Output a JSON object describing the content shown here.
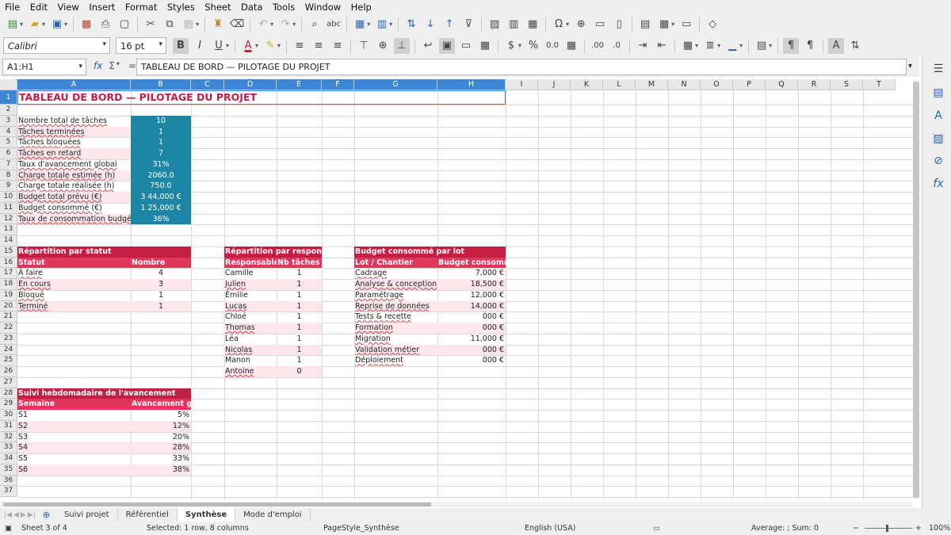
{
  "menu": [
    "File",
    "Edit",
    "View",
    "Insert",
    "Format",
    "Styles",
    "Sheet",
    "Data",
    "Tools",
    "Window",
    "Help"
  ],
  "font": {
    "name": "Calibri",
    "size": "16 pt"
  },
  "namebox": "A1:H1",
  "formula": "TABLEAU DE BORD — PILOTAGE DU PROJET",
  "columns": [
    "A",
    "B",
    "C",
    "D",
    "E",
    "F",
    "G",
    "H",
    "I",
    "J",
    "K",
    "L",
    "M",
    "N",
    "O",
    "P",
    "Q",
    "R",
    "S",
    "T"
  ],
  "title": "TABLEAU DE BORD — PILOTAGE DU PROJET",
  "kpis": [
    {
      "label": "Nombre total de tâches",
      "value": "10"
    },
    {
      "label": "Tâches terminées",
      "value": "1"
    },
    {
      "label": "Tâches bloquées",
      "value": "1"
    },
    {
      "label": "Tâches en retard",
      "value": "7"
    },
    {
      "label": "Taux d'avancement global",
      "value": "31%"
    },
    {
      "label": "Charge totale estimée (h)",
      "value": "2060.0"
    },
    {
      "label": "Charge totale réalisée (h)",
      "value": "750.0"
    },
    {
      "label": "Budget total prévu (€)",
      "value": "3 44,000 €"
    },
    {
      "label": "Budget consommé (€)",
      "value": "1 25,000 €"
    },
    {
      "label": "Taux de consommation budgétaire",
      "value": "36%"
    }
  ],
  "status_table": {
    "title": "Répartition par statut",
    "headers": [
      "Statut",
      "Nombre"
    ],
    "rows": [
      [
        "À faire",
        "4"
      ],
      [
        "En cours",
        "3"
      ],
      [
        "Bloqué",
        "1"
      ],
      [
        "Terminé",
        "1"
      ]
    ]
  },
  "resp_table": {
    "title": "Répartition par responsable",
    "headers": [
      "Responsable",
      "Nb tâches"
    ],
    "rows": [
      [
        "Camille",
        "1"
      ],
      [
        "Julien",
        "1"
      ],
      [
        "Émilie",
        "1"
      ],
      [
        "Lucas",
        "1"
      ],
      [
        "Chloé",
        "1"
      ],
      [
        "Thomas",
        "1"
      ],
      [
        "Léa",
        "1"
      ],
      [
        "Nicolas",
        "1"
      ],
      [
        "Manon",
        "1"
      ],
      [
        "Antoine",
        "0"
      ]
    ]
  },
  "budget_table": {
    "title": "Budget consommé par lot",
    "headers": [
      "Lot / Chantier",
      "Budget consommé (€"
    ],
    "rows": [
      [
        "Cadrage",
        "7,000 €"
      ],
      [
        "Analyse & conception",
        "18,500 €"
      ],
      [
        "Paramétrage",
        "12,000 €"
      ],
      [
        "Reprise de données",
        "14,000 €"
      ],
      [
        "Tests & recette",
        "000 €"
      ],
      [
        "Formation",
        "000 €"
      ],
      [
        "Migration",
        "11,000 €"
      ],
      [
        "Validation métier",
        "000 €"
      ],
      [
        "Déploiement",
        "000 €"
      ]
    ]
  },
  "weekly_table": {
    "title": "Suivi hebdomadaire de l'avancement",
    "headers": [
      "Semaine",
      "Avancement globa"
    ],
    "rows": [
      [
        "S1",
        "5%"
      ],
      [
        "S2",
        "12%"
      ],
      [
        "S3",
        "20%"
      ],
      [
        "S4",
        "28%"
      ],
      [
        "S5",
        "33%"
      ],
      [
        "S6",
        "38%"
      ]
    ]
  },
  "tabs": [
    "Suivi projet",
    "Référentiel",
    "Synthèse",
    "Mode d'emploi"
  ],
  "active_tab": "Synthèse",
  "status": {
    "sheet": "Sheet 3 of 4",
    "selection": "Selected: 1 row, 8 columns",
    "pagestyle": "PageStyle_Synthèse",
    "language": "English (USA)",
    "sum": "Average: ; Sum: 0",
    "zoom": "100%"
  },
  "colors": {
    "teal": "#1c86a4",
    "crimson": "#c41e45",
    "header_pink": "#e1365c",
    "row_pink": "#fde6ec",
    "selection_blue": "#3d86d6"
  }
}
